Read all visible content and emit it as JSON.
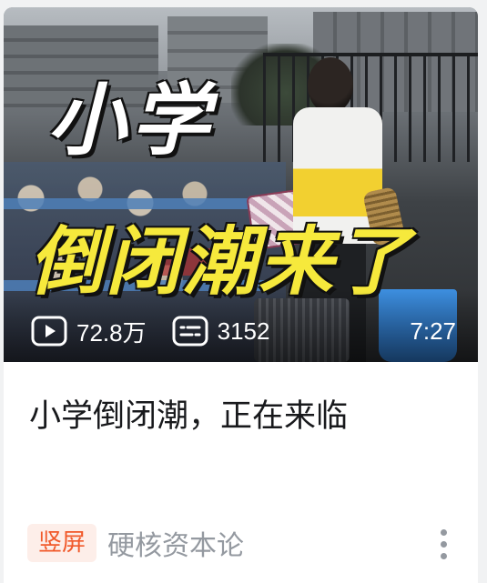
{
  "thumbnail": {
    "overlay_line1": "小学",
    "overlay_line2": "倒闭潮来了"
  },
  "stats": {
    "play_count": "72.8万",
    "danmaku_count": "3152",
    "duration": "7:27"
  },
  "video": {
    "title": "小学倒闭潮，正在来临"
  },
  "meta": {
    "tag": "竖屏",
    "author": "硬核资本论"
  },
  "icons": {
    "play": "play-count-icon",
    "danmaku": "danmaku-icon",
    "more": "more-vertical-icon"
  },
  "colors": {
    "tag_text": "#f1592a",
    "tag_bg": "#fdeee9",
    "overlay_yellow": "#f6e93c",
    "author_gray": "#9499a0"
  }
}
